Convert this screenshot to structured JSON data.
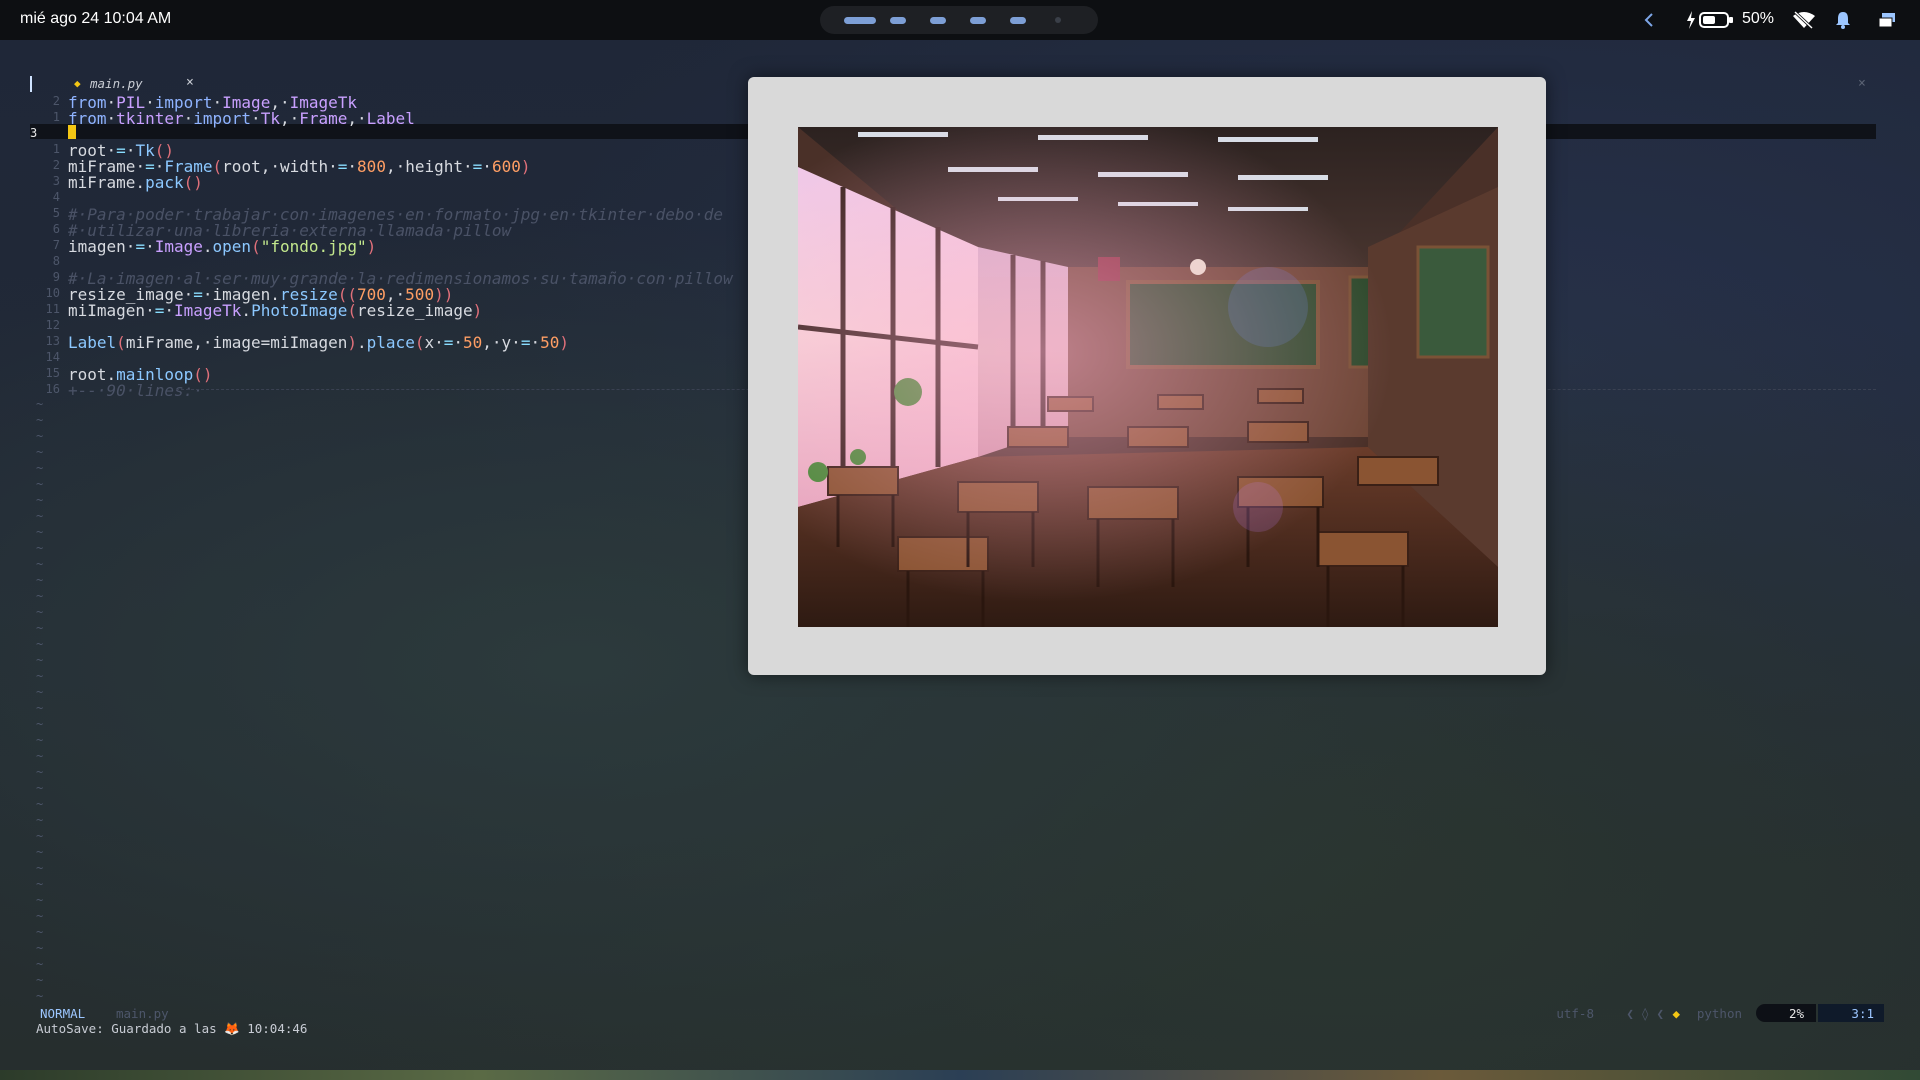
{
  "topbar": {
    "clock": "mié ago 24 10:04 AM",
    "battery_percent": "50%",
    "icons": [
      "chevron-left-icon",
      "charging-icon",
      "battery-icon",
      "wifi-off-icon",
      "bell-icon",
      "screens-icon"
    ]
  },
  "editor": {
    "tab": {
      "filename": "main.py",
      "close_glyph": "×"
    },
    "window_close_glyph": "×",
    "current_line_number": "3",
    "lines": [
      {
        "ln": "2",
        "tokens": [
          [
            "kw",
            "from"
          ],
          [
            "",
            "·"
          ],
          [
            "mod",
            "PIL"
          ],
          [
            "",
            "·"
          ],
          [
            "kw",
            "import"
          ],
          [
            "",
            "·"
          ],
          [
            "mod",
            "Image"
          ],
          [
            "",
            ",·"
          ],
          [
            "mod",
            "ImageTk"
          ]
        ]
      },
      {
        "ln": "1",
        "tokens": [
          [
            "kw",
            "from"
          ],
          [
            "",
            "·"
          ],
          [
            "mod",
            "tkinter"
          ],
          [
            "",
            "·"
          ],
          [
            "kw",
            "import"
          ],
          [
            "",
            "·"
          ],
          [
            "mod",
            "Tk"
          ],
          [
            "",
            ",·"
          ],
          [
            "mod",
            "Frame"
          ],
          [
            "",
            ",·"
          ],
          [
            "mod",
            "Label"
          ]
        ]
      },
      {
        "ln": "3",
        "tokens": []
      },
      {
        "ln": "1",
        "tokens": [
          [
            "",
            "root"
          ],
          [
            "",
            "·"
          ],
          [
            "op",
            "="
          ],
          [
            "",
            "·"
          ],
          [
            "fn",
            "Tk"
          ],
          [
            "par",
            "()"
          ]
        ]
      },
      {
        "ln": "2",
        "tokens": [
          [
            "",
            "miFrame"
          ],
          [
            "",
            "·"
          ],
          [
            "op",
            "="
          ],
          [
            "",
            "·"
          ],
          [
            "fn",
            "Frame"
          ],
          [
            "par",
            "("
          ],
          [
            "",
            "root,·width·"
          ],
          [
            "op",
            "="
          ],
          [
            "",
            "·"
          ],
          [
            "num",
            "800"
          ],
          [
            "",
            ",·height·"
          ],
          [
            "op",
            "="
          ],
          [
            "",
            "·"
          ],
          [
            "num",
            "600"
          ],
          [
            "par",
            ")"
          ]
        ]
      },
      {
        "ln": "3",
        "tokens": [
          [
            "",
            "miFrame."
          ],
          [
            "fn",
            "pack"
          ],
          [
            "par",
            "()"
          ]
        ]
      },
      {
        "ln": "4",
        "tokens": []
      },
      {
        "ln": "5",
        "tokens": [
          [
            "cm",
            "#·Para·poder·trabajar·con·imagenes·en·formato·jpg·en·tkinter·debo·de"
          ]
        ]
      },
      {
        "ln": "6",
        "tokens": [
          [
            "cm",
            "#·utilizar·una·libreria·externa·llamada·pillow"
          ]
        ]
      },
      {
        "ln": "7",
        "tokens": [
          [
            "",
            "imagen"
          ],
          [
            "",
            "·"
          ],
          [
            "op",
            "="
          ],
          [
            "",
            "·"
          ],
          [
            "mod",
            "Image"
          ],
          [
            "",
            "."
          ],
          [
            "fn",
            "open"
          ],
          [
            "par",
            "("
          ],
          [
            "str",
            "\"fondo.jpg\""
          ],
          [
            "par",
            ")"
          ]
        ]
      },
      {
        "ln": "8",
        "tokens": []
      },
      {
        "ln": "9",
        "tokens": [
          [
            "cm",
            "#·La·imagen·al·ser·muy·grande·la·redimensionamos·su·tamaño·con·pillow"
          ]
        ]
      },
      {
        "ln": "10",
        "tokens": [
          [
            "",
            "resize_image"
          ],
          [
            "",
            "·"
          ],
          [
            "op",
            "="
          ],
          [
            "",
            "·imagen."
          ],
          [
            "fn",
            "resize"
          ],
          [
            "par",
            "(("
          ],
          [
            "num",
            "700"
          ],
          [
            "",
            ",·"
          ],
          [
            "num",
            "500"
          ],
          [
            "par",
            "))"
          ]
        ]
      },
      {
        "ln": "11",
        "tokens": [
          [
            "",
            "miImagen"
          ],
          [
            "",
            "·"
          ],
          [
            "op",
            "="
          ],
          [
            "",
            "·"
          ],
          [
            "mod",
            "ImageTk"
          ],
          [
            "",
            "."
          ],
          [
            "fn",
            "PhotoImage"
          ],
          [
            "par",
            "("
          ],
          [
            "",
            "resize_image"
          ],
          [
            "par",
            ")"
          ]
        ]
      },
      {
        "ln": "12",
        "tokens": []
      },
      {
        "ln": "13",
        "tokens": [
          [
            "fn",
            "Label"
          ],
          [
            "par",
            "("
          ],
          [
            "",
            "miFrame,·image=miImagen"
          ],
          [
            "par",
            ")"
          ],
          [
            "",
            "."
          ],
          [
            "fn",
            "place"
          ],
          [
            "par",
            "("
          ],
          [
            "",
            "x·"
          ],
          [
            "op",
            "="
          ],
          [
            "",
            "·"
          ],
          [
            "num",
            "50"
          ],
          [
            "",
            ",·y·"
          ],
          [
            "op",
            "="
          ],
          [
            "",
            "·"
          ],
          [
            "num",
            "50"
          ],
          [
            "par",
            ")"
          ]
        ]
      },
      {
        "ln": "14",
        "tokens": []
      },
      {
        "ln": "15",
        "tokens": [
          [
            "",
            "root."
          ],
          [
            "fn",
            "mainloop"
          ],
          [
            "par",
            "()"
          ]
        ]
      },
      {
        "ln": "16",
        "tokens": [
          [
            "cm",
            "+--·90·lines:·"
          ]
        ]
      }
    ],
    "tilde_count": 38
  },
  "statusline": {
    "mode": "NORMAL",
    "file": "main.py",
    "encoding": "utf-8",
    "separators": "❮ ◊ ❮",
    "language_icon": "◆",
    "language": "python",
    "percent": "2%",
    "position": "3:1"
  },
  "message": {
    "text": "AutoSave: Guardado a las 🦊 10:04:46"
  },
  "tk_window": {
    "image_description_icon": "classroom-photo"
  }
}
